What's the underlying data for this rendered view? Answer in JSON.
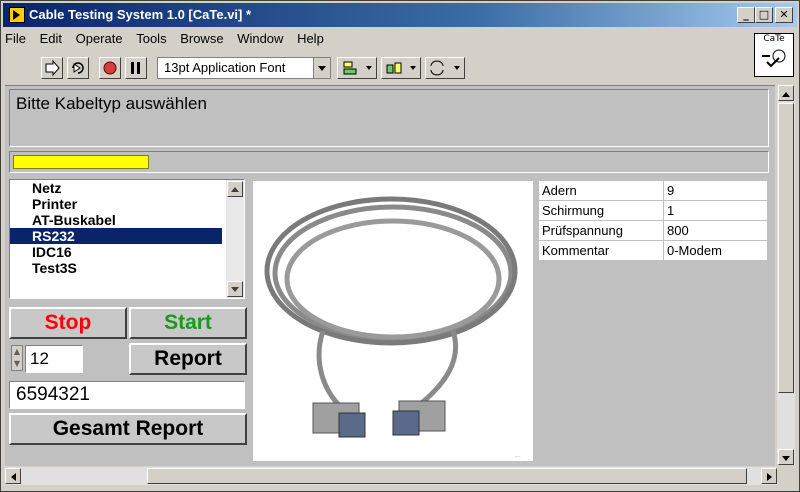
{
  "window": {
    "title": "Cable Testing System 1.0 [CaTe.vi] *",
    "controls": {
      "minimize": "_",
      "maximize": "□",
      "close": "✕"
    }
  },
  "menu": [
    {
      "label": "File"
    },
    {
      "label": "Edit"
    },
    {
      "label": "Operate"
    },
    {
      "label": "Tools"
    },
    {
      "label": "Browse"
    },
    {
      "label": "Window"
    },
    {
      "label": "Help"
    }
  ],
  "toolbar": {
    "font_select": "13pt Application Font",
    "icons": [
      "run-arrow-icon",
      "run-continuous-icon",
      "abort-icon",
      "pause-icon",
      "align-icon",
      "distribute-icon",
      "reorder-icon"
    ]
  },
  "logo": {
    "text": "CaTe"
  },
  "front_panel": {
    "message": "Bitte Kabeltyp auswählen",
    "progress": 0.18,
    "progress_color": "#ffff00",
    "cable_list": {
      "items": [
        "Netz",
        "Printer",
        "AT-Buskabel",
        "RS232",
        "IDC16",
        "Test3S"
      ],
      "selected_index": 3
    },
    "buttons": {
      "stop": "Stop",
      "start": "Start",
      "report": "Report",
      "total_report": "Gesamt Report"
    },
    "button_colors": {
      "stop": "#ff0000",
      "start": "#1a9a1a"
    },
    "count_value": "12",
    "serial_value": "6594321",
    "properties": [
      {
        "key": "Adern",
        "value": "9"
      },
      {
        "key": "Schirmung",
        "value": "1"
      },
      {
        "key": "Prüfspannung",
        "value": "800"
      },
      {
        "key": "Kommentar",
        "value": "0-Modem"
      }
    ],
    "image_caption": "..."
  }
}
